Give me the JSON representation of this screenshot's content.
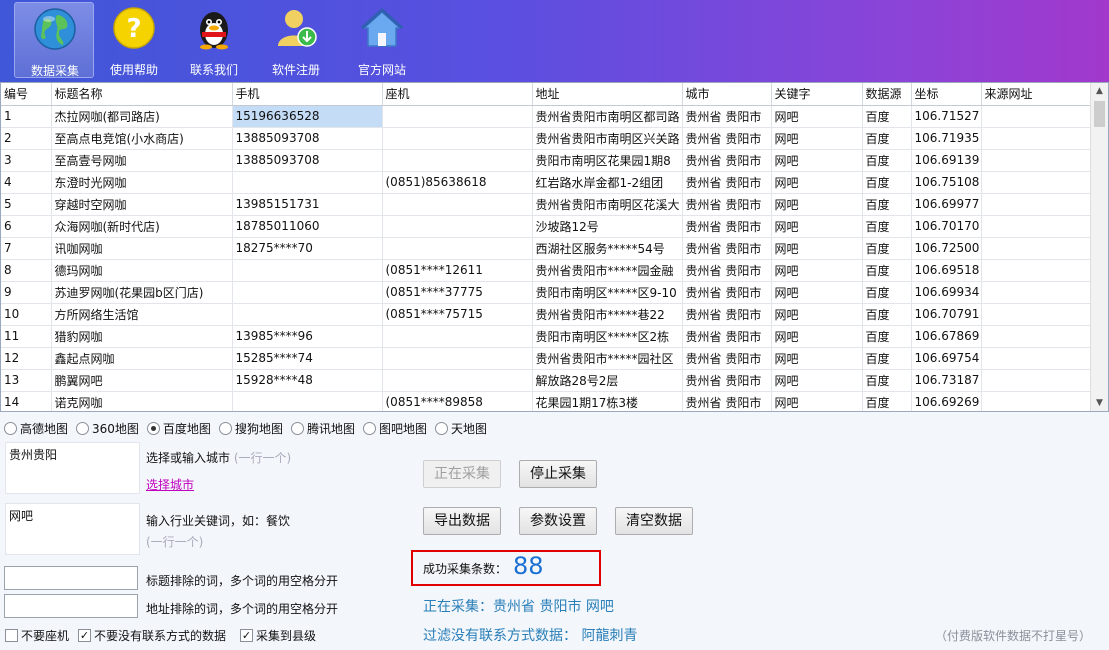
{
  "toolbar": {
    "buttons": [
      {
        "label": "数据采集",
        "icon": "globe-icon",
        "active": true
      },
      {
        "label": "使用帮助",
        "icon": "question-icon",
        "active": false
      },
      {
        "label": "联系我们",
        "icon": "qq-penguin-icon",
        "active": false
      },
      {
        "label": "软件注册",
        "icon": "user-download-icon",
        "active": false
      },
      {
        "label": "官方网站",
        "icon": "home-icon",
        "active": false
      }
    ]
  },
  "table": {
    "headers": [
      "编号",
      "标题名称",
      "手机",
      "座机",
      "地址",
      "城市",
      "关键字",
      "数据源",
      "坐标",
      "来源网址"
    ],
    "rows": [
      [
        "1",
        "杰拉网咖(都司路店)",
        "15196636528",
        "",
        "贵州省贵阳市南明区都司路",
        "贵州省 贵阳市",
        "网吧",
        "百度",
        "106.71527",
        ""
      ],
      [
        "2",
        "至高点电竞馆(小水商店)",
        "13885093708",
        "",
        "贵州省贵阳市南明区兴关路",
        "贵州省 贵阳市",
        "网吧",
        "百度",
        "106.71935",
        ""
      ],
      [
        "3",
        "至高壹号网咖",
        "13885093708",
        "",
        "贵阳市南明区花果园1期8",
        "贵州省 贵阳市",
        "网吧",
        "百度",
        "106.69139",
        ""
      ],
      [
        "4",
        "东澄时光网咖",
        "",
        "(0851)85638618",
        "红岩路水岸金都1-2组团",
        "贵州省 贵阳市",
        "网吧",
        "百度",
        "106.75108",
        ""
      ],
      [
        "5",
        "穿越时空网咖",
        "13985151731",
        "",
        "贵州省贵阳市南明区花溪大",
        "贵州省 贵阳市",
        "网吧",
        "百度",
        "106.69977",
        ""
      ],
      [
        "6",
        "众海网咖(新时代店)",
        "18785011060",
        "",
        "沙坡路12号",
        "贵州省 贵阳市",
        "网吧",
        "百度",
        "106.70170",
        ""
      ],
      [
        "7",
        "讯咖网咖",
        "18275****70",
        "",
        "西湖社区服务*****54号",
        "贵州省 贵阳市",
        "网吧",
        "百度",
        "106.72500",
        ""
      ],
      [
        "8",
        "德玛网咖",
        "",
        "(0851****12611",
        "贵州省贵阳市*****园金融",
        "贵州省 贵阳市",
        "网吧",
        "百度",
        "106.69518",
        ""
      ],
      [
        "9",
        "苏迪罗网咖(花果园b区门店)",
        "",
        "(0851****37775",
        "贵阳市南明区*****区9-10",
        "贵州省 贵阳市",
        "网吧",
        "百度",
        "106.69934",
        ""
      ],
      [
        "10",
        "方所网络生活馆",
        "",
        "(0851****75715",
        "贵州省贵阳市*****巷22",
        "贵州省 贵阳市",
        "网吧",
        "百度",
        "106.70791",
        ""
      ],
      [
        "11",
        "猎豹网咖",
        "13985****96",
        "",
        "贵阳市南明区*****区2栋",
        "贵州省 贵阳市",
        "网吧",
        "百度",
        "106.67869",
        ""
      ],
      [
        "12",
        "鑫起点网咖",
        "15285****74",
        "",
        "贵州省贵阳市*****园社区",
        "贵州省 贵阳市",
        "网吧",
        "百度",
        "106.69754",
        ""
      ],
      [
        "13",
        "鹏翼网吧",
        "15928****48",
        "",
        "解放路28号2层",
        "贵州省 贵阳市",
        "网吧",
        "百度",
        "106.73187",
        ""
      ],
      [
        "14",
        "诺克网咖",
        "",
        "(0851****89858",
        "花果园1期17栋3楼",
        "贵州省 贵阳市",
        "网吧",
        "百度",
        "106.69269",
        ""
      ]
    ],
    "selected_cell": {
      "row": 0,
      "col": 2
    }
  },
  "map_sources": {
    "options": [
      "高德地图",
      "360地图",
      "百度地图",
      "搜狗地图",
      "腾讯地图",
      "图吧地图",
      "天地图"
    ],
    "selected": "百度地图"
  },
  "city": {
    "value": "贵州贵阳",
    "label": "选择或输入城市",
    "hint": "(一行一个)",
    "link": "选择城市"
  },
  "keyword": {
    "value": "网吧",
    "label": "输入行业关键词，如：餐饮",
    "hint": "(一行一个)"
  },
  "exclude": {
    "title_label": "标题排除的词，多个词的用空格分开",
    "address_label": "地址排除的词，多个词的用空格分开",
    "title_value": "",
    "address_value": ""
  },
  "options": [
    {
      "label": "不要座机",
      "checked": false
    },
    {
      "label": "不要没有联系方式的数据",
      "checked": true
    },
    {
      "label": "采集到县级",
      "checked": true
    }
  ],
  "buttons": {
    "collecting": "正在采集",
    "stop": "停止采集",
    "export": "导出数据",
    "settings": "参数设置",
    "clear": "清空数据"
  },
  "result": {
    "label": "成功采集条数：",
    "count": "88"
  },
  "status": {
    "collecting": "正在采集：贵州省 贵阳市 网吧",
    "filtered": "过滤没有联系方式数据：  阿龍刺青"
  },
  "footnote": "（付费版软件数据不打星号）",
  "colors": {
    "toolbar_start": "#3f57d8",
    "toolbar_end": "#a238cc",
    "count": "#1a6fd3",
    "status": "#2a7fb8",
    "highlight_border": "#e00000"
  }
}
